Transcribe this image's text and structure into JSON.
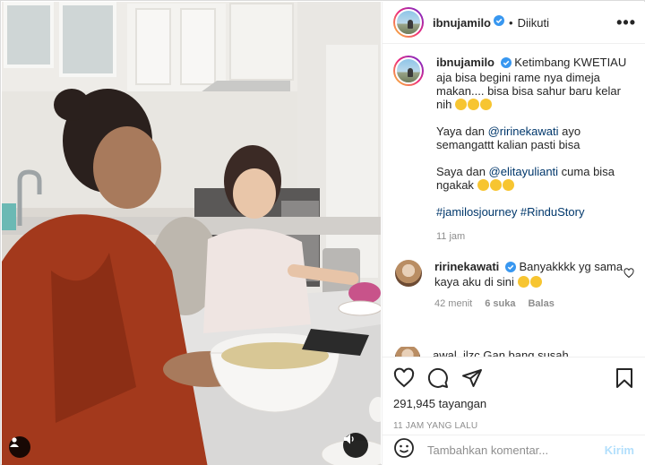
{
  "header": {
    "username": "ibnujamilo",
    "separator": "•",
    "follow_state": "Diikuti",
    "more": "•••"
  },
  "caption": {
    "username": "ibnujamilo",
    "line1": "Ketimbang KWETIAU aja bisa begini rame nya dimeja makan.... bisa bisa sahur baru kelar nih",
    "para2_pre": "Yaya dan ",
    "para2_mention": "@ririnekawati",
    "para2_post": " ayo semangattt kalian pasti bisa",
    "para3_pre": "Saya dan ",
    "para3_mention": "@elitayulianti",
    "para3_post": " cuma bisa ngakak",
    "hashtags": "#jamilosjourney #RinduStory",
    "time": "11 jam"
  },
  "comments": [
    {
      "username": "ririnekawati",
      "text": "Banyakkkk yg sama kaya aku di sini",
      "time": "42 menit",
      "likes": "6 suka",
      "reply": "Balas"
    }
  ],
  "partial_comment": "awal_ilzc  Gan bang susah",
  "actions": {
    "views_count": "291,945",
    "views_label": "tayangan",
    "posted": "11 JAM YANG LALU"
  },
  "comment_box": {
    "placeholder": "Tambahkan komentar...",
    "post_label": "Kirim"
  },
  "icons": {
    "verified": "verified-badge-icon",
    "like": "heart-icon",
    "comment": "speech-bubble-icon",
    "share": "paper-plane-icon",
    "save": "bookmark-icon",
    "emoji": "smiley-icon",
    "sound": "speaker-icon",
    "tag": "user-tag-icon"
  },
  "colors": {
    "verified": "#3897f0",
    "link": "#00376b",
    "muted": "#8e8e8e",
    "post_disabled": "#b2dffc"
  }
}
